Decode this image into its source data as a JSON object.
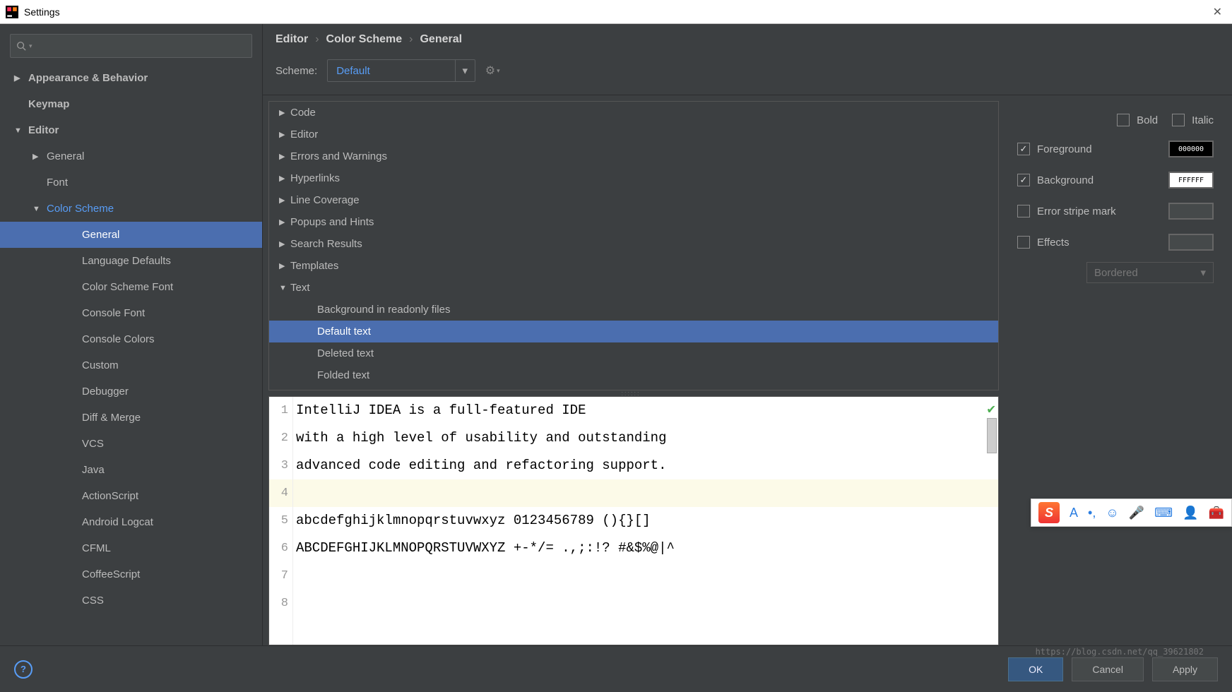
{
  "window": {
    "title": "Settings"
  },
  "sidebar": {
    "items": [
      {
        "label": "Appearance & Behavior",
        "arrow": "▶",
        "bold": true,
        "lvl": 0
      },
      {
        "label": "Keymap",
        "arrow": "",
        "bold": true,
        "lvl": 0
      },
      {
        "label": "Editor",
        "arrow": "▼",
        "bold": true,
        "lvl": 0
      },
      {
        "label": "General",
        "arrow": "▶",
        "bold": false,
        "lvl": 1
      },
      {
        "label": "Font",
        "arrow": "",
        "bold": false,
        "lvl": 1
      },
      {
        "label": "Color Scheme",
        "arrow": "▼",
        "bold": false,
        "lvl": 1,
        "link": true
      },
      {
        "label": "General",
        "arrow": "",
        "bold": false,
        "lvl": 3,
        "selected": true
      },
      {
        "label": "Language Defaults",
        "arrow": "",
        "bold": false,
        "lvl": 3
      },
      {
        "label": "Color Scheme Font",
        "arrow": "",
        "bold": false,
        "lvl": 3
      },
      {
        "label": "Console Font",
        "arrow": "",
        "bold": false,
        "lvl": 3
      },
      {
        "label": "Console Colors",
        "arrow": "",
        "bold": false,
        "lvl": 3
      },
      {
        "label": "Custom",
        "arrow": "",
        "bold": false,
        "lvl": 3
      },
      {
        "label": "Debugger",
        "arrow": "",
        "bold": false,
        "lvl": 3
      },
      {
        "label": "Diff & Merge",
        "arrow": "",
        "bold": false,
        "lvl": 3
      },
      {
        "label": "VCS",
        "arrow": "",
        "bold": false,
        "lvl": 3
      },
      {
        "label": "Java",
        "arrow": "",
        "bold": false,
        "lvl": 3
      },
      {
        "label": "ActionScript",
        "arrow": "",
        "bold": false,
        "lvl": 3
      },
      {
        "label": "Android Logcat",
        "arrow": "",
        "bold": false,
        "lvl": 3
      },
      {
        "label": "CFML",
        "arrow": "",
        "bold": false,
        "lvl": 3
      },
      {
        "label": "CoffeeScript",
        "arrow": "",
        "bold": false,
        "lvl": 3
      },
      {
        "label": "CSS",
        "arrow": "",
        "bold": false,
        "lvl": 3
      }
    ]
  },
  "breadcrumb": {
    "a": "Editor",
    "b": "Color Scheme",
    "c": "General"
  },
  "scheme": {
    "label": "Scheme:",
    "value": "Default"
  },
  "categories": [
    {
      "label": "Code",
      "arrow": "▶"
    },
    {
      "label": "Editor",
      "arrow": "▶"
    },
    {
      "label": "Errors and Warnings",
      "arrow": "▶"
    },
    {
      "label": "Hyperlinks",
      "arrow": "▶"
    },
    {
      "label": "Line Coverage",
      "arrow": "▶"
    },
    {
      "label": "Popups and Hints",
      "arrow": "▶"
    },
    {
      "label": "Search Results",
      "arrow": "▶"
    },
    {
      "label": "Templates",
      "arrow": "▶"
    },
    {
      "label": "Text",
      "arrow": "▼"
    },
    {
      "label": "Background in readonly files",
      "arrow": "",
      "sub": true
    },
    {
      "label": "Default text",
      "arrow": "",
      "sub": true,
      "selected": true
    },
    {
      "label": "Deleted text",
      "arrow": "",
      "sub": true
    },
    {
      "label": "Folded text",
      "arrow": "",
      "sub": true
    }
  ],
  "props": {
    "bold": "Bold",
    "italic": "Italic",
    "foreground": "Foreground",
    "background": "Background",
    "error_stripe": "Error stripe mark",
    "effects": "Effects",
    "fg_val": "000000",
    "bg_val": "FFFFFF",
    "effects_type": "Bordered"
  },
  "preview": {
    "lines": [
      "IntelliJ IDEA is a full-featured IDE",
      "with a high level of usability and outstanding",
      "advanced code editing and refactoring support.",
      "",
      "abcdefghijklmnopqrstuvwxyz 0123456789 (){}[]",
      "ABCDEFGHIJKLMNOPQRSTUVWXYZ +-*/= .,;:!? #&$%@|^",
      "",
      ""
    ]
  },
  "buttons": {
    "ok": "OK",
    "cancel": "Cancel",
    "apply": "Apply"
  },
  "watermark": "https://blog.csdn.net/qq_39621802"
}
